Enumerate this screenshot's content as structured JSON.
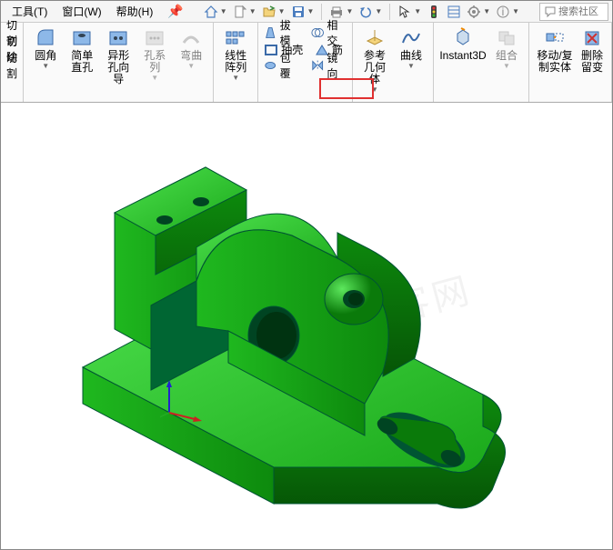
{
  "menu": {
    "tools": "工具(T)",
    "window": "窗口(W)",
    "help": "帮助(H)"
  },
  "search": {
    "placeholder": "搜索社区"
  },
  "ribbon": {
    "g1": {
      "cut1": "切割",
      "cut2": "切除",
      "cut3": "切割"
    },
    "fillet": "圆角",
    "simpleHole": "简单直孔",
    "holeWizard": "异形孔向导",
    "holeSeries": "孔系列",
    "bend": "弯曲",
    "linearPattern": "线性阵列",
    "draft": "拔模",
    "intersect": "相交",
    "shell": "抽壳",
    "rib": "筋",
    "wrap": "包覆",
    "mirror": "镜向",
    "refGeom": "参考几何体",
    "curves": "曲线",
    "instant3d": "Instant3D",
    "combine": "组合",
    "moveCopy": "移动/复制实体",
    "delete": "删除留变"
  }
}
